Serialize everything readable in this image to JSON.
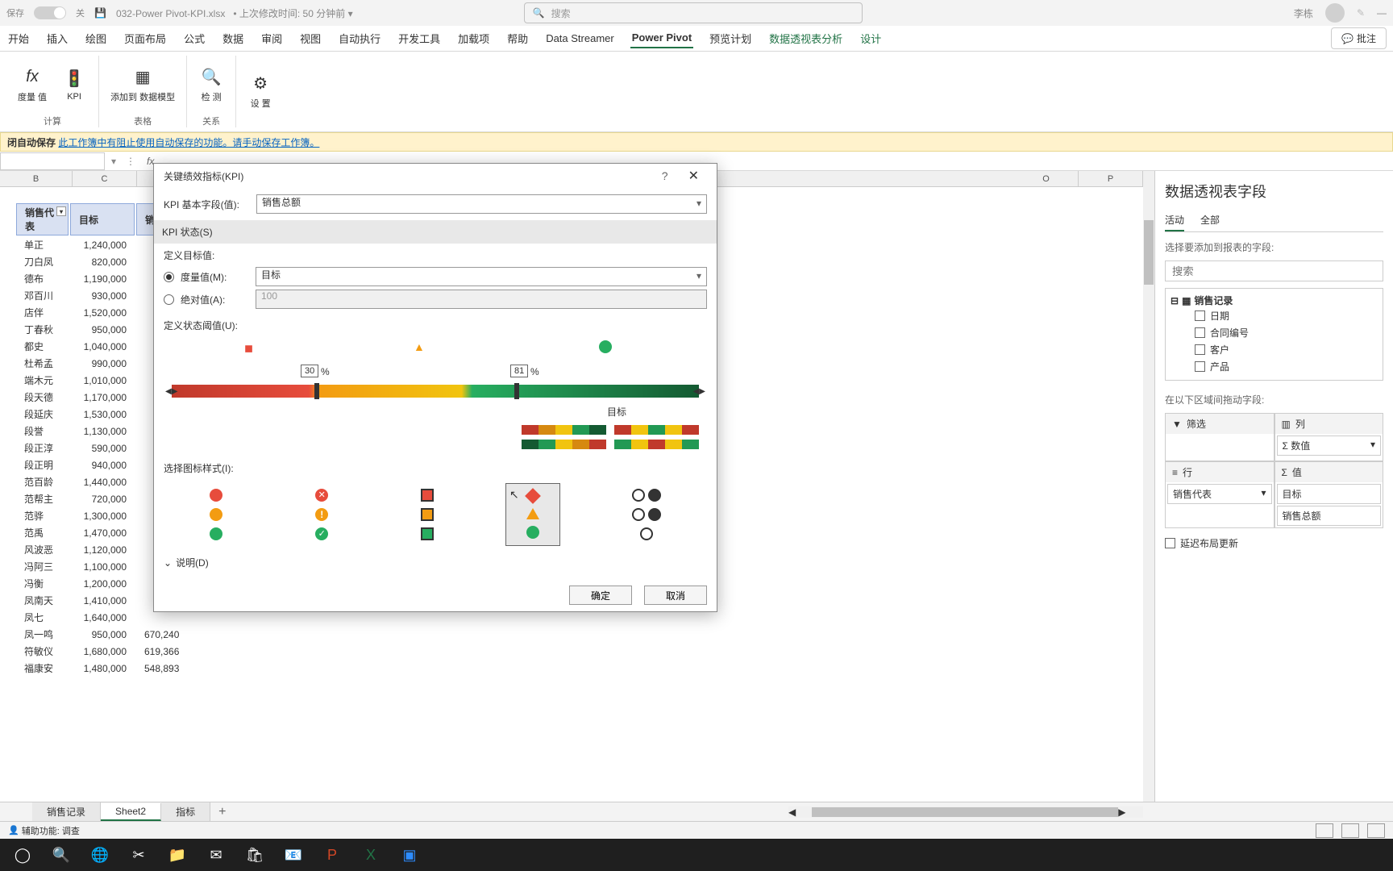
{
  "titlebar": {
    "autosave_label": "保存",
    "autosave_state": "关",
    "filename": "032-Power Pivot-KPI.xlsx",
    "last_modified": "上次修改时间: 50 分钟前",
    "search_placeholder": "搜索",
    "username": "李栋"
  },
  "ribbon": {
    "tabs": [
      "开始",
      "插入",
      "绘图",
      "页面布局",
      "公式",
      "数据",
      "审阅",
      "视图",
      "自动执行",
      "开发工具",
      "加载项",
      "帮助",
      "Data Streamer",
      "Power Pivot",
      "预览计划",
      "数据透视表分析",
      "设计"
    ],
    "comments_btn": "批注",
    "groups": {
      "calc": "计算",
      "table": "表格",
      "relation": "关系",
      "buttons": {
        "measure": "度量\n值",
        "kpi": "KPI",
        "add_to_model": "添加到\n数据模型",
        "detect": "检\n测",
        "settings": "设\n置"
      }
    }
  },
  "warning": {
    "prefix": "闭自动保存",
    "link": "此工作簿中有阻止使用自动保存的功能。请手动保存工作簿。"
  },
  "formula": {
    "fx": "fx"
  },
  "table": {
    "headers": [
      "销售代表",
      "目标",
      "销"
    ],
    "rows": [
      {
        "name": "单正",
        "target": "1,240,000",
        "actual": ""
      },
      {
        "name": "刀白凤",
        "target": "820,000",
        "actual": ""
      },
      {
        "name": "德布",
        "target": "1,190,000",
        "actual": ""
      },
      {
        "name": "邓百川",
        "target": "930,000",
        "actual": ""
      },
      {
        "name": "店伴",
        "target": "1,520,000",
        "actual": ""
      },
      {
        "name": "丁春秋",
        "target": "950,000",
        "actual": ""
      },
      {
        "name": "都史",
        "target": "1,040,000",
        "actual": ""
      },
      {
        "name": "杜希孟",
        "target": "990,000",
        "actual": ""
      },
      {
        "name": "端木元",
        "target": "1,010,000",
        "actual": ""
      },
      {
        "name": "段天德",
        "target": "1,170,000",
        "actual": ""
      },
      {
        "name": "段延庆",
        "target": "1,530,000",
        "actual": ""
      },
      {
        "name": "段誉",
        "target": "1,130,000",
        "actual": ""
      },
      {
        "name": "段正淳",
        "target": "590,000",
        "actual": ""
      },
      {
        "name": "段正明",
        "target": "940,000",
        "actual": ""
      },
      {
        "name": "范百龄",
        "target": "1,440,000",
        "actual": ""
      },
      {
        "name": "范帮主",
        "target": "720,000",
        "actual": ""
      },
      {
        "name": "范骅",
        "target": "1,300,000",
        "actual": ""
      },
      {
        "name": "范禹",
        "target": "1,470,000",
        "actual": ""
      },
      {
        "name": "风波恶",
        "target": "1,120,000",
        "actual": ""
      },
      {
        "name": "冯阿三",
        "target": "1,100,000",
        "actual": ""
      },
      {
        "name": "冯衡",
        "target": "1,200,000",
        "actual": ""
      },
      {
        "name": "凤南天",
        "target": "1,410,000",
        "actual": ""
      },
      {
        "name": "凤七",
        "target": "1,640,000",
        "actual": ""
      },
      {
        "name": "凤一鸣",
        "target": "950,000",
        "actual": "670,240"
      },
      {
        "name": "符敏仪",
        "target": "1,680,000",
        "actual": "619,366"
      },
      {
        "name": "福康安",
        "target": "1,480,000",
        "actual": "548,893"
      }
    ]
  },
  "dialog": {
    "title": "关键绩效指标(KPI)",
    "base_field_label": "KPI 基本字段(值):",
    "base_field_value": "销售总额",
    "status_section": "KPI 状态(S)",
    "define_target": "定义目标值:",
    "measure_radio": "度量值(M):",
    "measure_value": "目标",
    "absolute_radio": "绝对值(A):",
    "absolute_value": "100",
    "threshold_label": "定义状态阈值(U):",
    "threshold_low": "30",
    "threshold_high": "81",
    "percent": "%",
    "target_label": "目标",
    "icon_style_label": "选择图标样式(I):",
    "description": "说明(D)",
    "ok": "确定",
    "cancel": "取消"
  },
  "fieldlist": {
    "title": "数据透视表字段",
    "tab_active": "活动",
    "tab_all": "全部",
    "hint": "选择要添加到报表的字段:",
    "search": "搜索",
    "table_name": "销售记录",
    "fields": [
      "日期",
      "合同编号",
      "客户",
      "产品"
    ],
    "drop_hint": "在以下区域间拖动字段:",
    "filter": "筛选",
    "columns": "列",
    "rows_label": "行",
    "values_label": "值",
    "col_item": "数值",
    "row_item": "销售代表",
    "val_items": [
      "目标",
      "销售总额"
    ],
    "defer": "延迟布局更新"
  },
  "sheets": {
    "tabs": [
      "销售记录",
      "Sheet2",
      "指标"
    ],
    "active": 1
  },
  "statusbar": {
    "accessibility": "辅助功能: 调查"
  },
  "col_letters": [
    "B",
    "C",
    "O",
    "P"
  ]
}
